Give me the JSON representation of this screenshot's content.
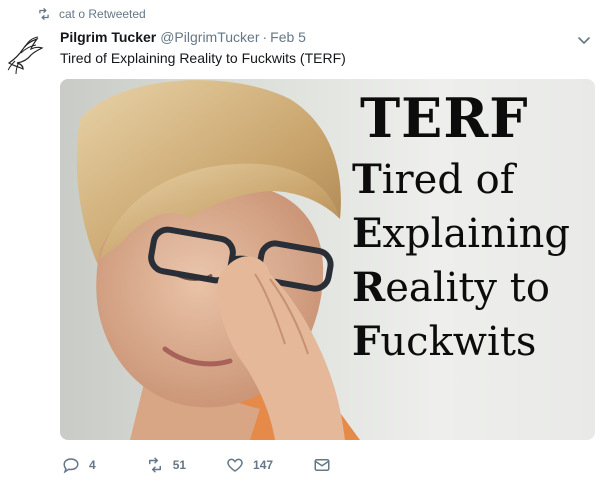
{
  "retweet_banner": {
    "text": "cat o Retweeted",
    "icon": "retweet-icon"
  },
  "tweet": {
    "display_name": "Pilgrim Tucker",
    "handle": "@PilgrimTucker",
    "separator": "·",
    "date": "Feb 5",
    "text": "Tired of Explaining Reality to Fuckwits (TERF)",
    "avatar_icon": "bird-icon"
  },
  "media": {
    "title": "TERF",
    "lines": [
      {
        "cap": "T",
        "rest": "ired of"
      },
      {
        "cap": "E",
        "rest": "xplaining"
      },
      {
        "cap": "R",
        "rest": "eality to"
      },
      {
        "cap": "F",
        "rest": "uckwits"
      }
    ]
  },
  "actions": {
    "reply_count": "4",
    "retweet_count": "51",
    "like_count": "147"
  },
  "colors": {
    "text_primary": "#14171a",
    "text_secondary": "#657786",
    "background": "#ffffff"
  }
}
